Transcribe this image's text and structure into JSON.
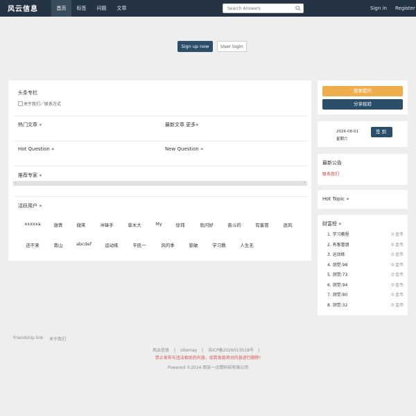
{
  "header": {
    "logo": "风云信息",
    "nav": [
      "首页",
      "标签",
      "问题",
      "文章"
    ],
    "search_placeholder": "Search Answers",
    "sign_in": "Sign in",
    "register": "Register"
  },
  "hero": {
    "signup": "Sign up now",
    "login": "User login"
  },
  "main": {
    "headline_title": "头条专栏",
    "headline_image_alt": "关于我们／联系方式",
    "hot_articles": "热门文章 »",
    "latest_articles": "最新文章 更多»",
    "hot_question": "Hot Question »",
    "new_question": "New Question »",
    "recommended_experts": "推荐专家 »",
    "active_users_title": "活跃用户 »",
    "active_users": [
      "xxxxxa",
      "谢青",
      "微笑",
      "冲锋手",
      "草木大",
      "My",
      "徐玮",
      "就问好",
      "奋斗的",
      "有客冒",
      "逐风",
      "还不来",
      "南山",
      "abcdef",
      "运动练",
      "平民一",
      "风的季",
      "狼破",
      "学习教",
      "人生无"
    ]
  },
  "sidebar": {
    "ask_button": "我要提问",
    "share_button": "分享经验",
    "date": "2026-08-01",
    "weekday": "星期六",
    "checkin": "签到",
    "announcement_title": "最新公告",
    "announcement_link": "联系我们",
    "hot_topic": "Hot Topic »",
    "rich_title": "财富榜 »",
    "rich_list": [
      {
        "rank": "1.",
        "name": "学习教程",
        "coins": "0 金币"
      },
      {
        "rank": "2.",
        "name": "有客冒朋",
        "coins": "0 金币"
      },
      {
        "rank": "3.",
        "name": "运动练",
        "coins": "0 金币"
      },
      {
        "rank": "4.",
        "name": "测觉:98",
        "coins": "0 金币"
      },
      {
        "rank": "5.",
        "name": "测觉:73",
        "coins": "0 金币"
      },
      {
        "rank": "6.",
        "name": "测觉:94",
        "coins": "0 金币"
      },
      {
        "rank": "7.",
        "name": "测觉:80",
        "coins": "0 金币"
      },
      {
        "rank": "8.",
        "name": "测觉:32",
        "coins": "0 金币"
      }
    ]
  },
  "footer": {
    "friendship_link": "Friendship link",
    "about_us": "关于我们",
    "site_name": "风云信息",
    "sitemap": "sitemap",
    "icp": "苏ICP备2026013518号",
    "warning": "禁止发布与违法相关的内容，如若发现将对内容进行删除!",
    "powered": "Powered ©2024 西安一点情科技有限公司"
  },
  "colors": {
    "topbar": "#243444",
    "primary": "#2b4e6b",
    "orange": "#f0ad4e",
    "link_red": "#c0392b",
    "warning_red": "#d9534f"
  }
}
